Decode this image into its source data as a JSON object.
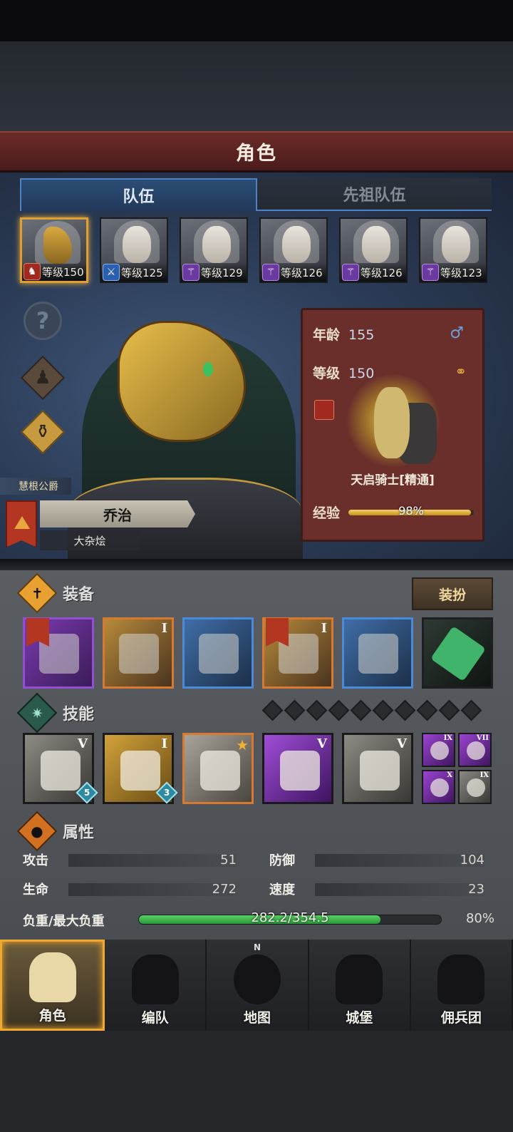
{
  "header": {
    "title": "角色"
  },
  "tabs": [
    {
      "label": "队伍",
      "active": true
    },
    {
      "label": "先祖队伍",
      "active": false
    }
  ],
  "team": [
    {
      "level_text": "等级150",
      "class_color": "red",
      "selected": true
    },
    {
      "level_text": "等级125",
      "class_color": "blue",
      "selected": false
    },
    {
      "level_text": "等级129",
      "class_color": "purple",
      "selected": false
    },
    {
      "level_text": "等级126",
      "class_color": "purple",
      "selected": false
    },
    {
      "level_text": "等级126",
      "class_color": "purple",
      "selected": false
    },
    {
      "level_text": "等级123",
      "class_color": "purple",
      "selected": false
    }
  ],
  "hero": {
    "title": "慧根公爵",
    "name": "乔治",
    "trait": "大杂烩",
    "age_label": "年龄",
    "age": "155",
    "level_label": "等级",
    "level": "150",
    "gender_icon": "male-icon",
    "unit_name": "天启骑士[精通]",
    "exp_label": "经验",
    "exp_text": "98%",
    "exp_value": 0.98
  },
  "equipment": {
    "title": "装备",
    "dress_label": "装扮",
    "slots": [
      {
        "rarity": "purple",
        "tier": "",
        "icon": "mace-icon"
      },
      {
        "rarity": "orange",
        "tier": "I",
        "icon": "shield-icon"
      },
      {
        "rarity": "blue",
        "tier": "",
        "icon": "helmet-icon"
      },
      {
        "rarity": "orange",
        "tier": "I",
        "icon": "armor-icon"
      },
      {
        "rarity": "blue",
        "tier": "",
        "icon": "boots-icon"
      },
      {
        "rarity": "green",
        "tier": "",
        "icon": "potion-icon"
      }
    ]
  },
  "skills": {
    "title": "技能",
    "slots": [
      {
        "tier": "V",
        "badge": "5",
        "icon": "lance-icon"
      },
      {
        "tier": "I",
        "badge": "3",
        "icon": "heal-shield-icon"
      },
      {
        "tier": "",
        "badge": "",
        "icon": "gauntlet-icon",
        "starred": true
      },
      {
        "tier": "V",
        "badge": "",
        "icon": "crystal-fist-icon"
      },
      {
        "tier": "V",
        "badge": "",
        "icon": "crystal-fist-icon"
      }
    ],
    "mini": [
      {
        "tier": "IX"
      },
      {
        "tier": "VII"
      },
      {
        "tier": "X"
      },
      {
        "tier": "IX"
      }
    ]
  },
  "attributes": {
    "title": "属性",
    "attack_label": "攻击",
    "attack": "51",
    "defense_label": "防御",
    "defense": "104",
    "hp_label": "生命",
    "hp": "272",
    "speed_label": "速度",
    "speed": "23",
    "load_label": "负重/最大负重",
    "load_text": "282.2/354.5",
    "load_pct": "80%",
    "load_value": 0.8
  },
  "nav": [
    {
      "label": "角色",
      "active": true
    },
    {
      "label": "编队",
      "active": false
    },
    {
      "label": "地图",
      "active": false,
      "compass": "N"
    },
    {
      "label": "城堡",
      "active": false
    },
    {
      "label": "佣兵团",
      "active": false
    }
  ]
}
